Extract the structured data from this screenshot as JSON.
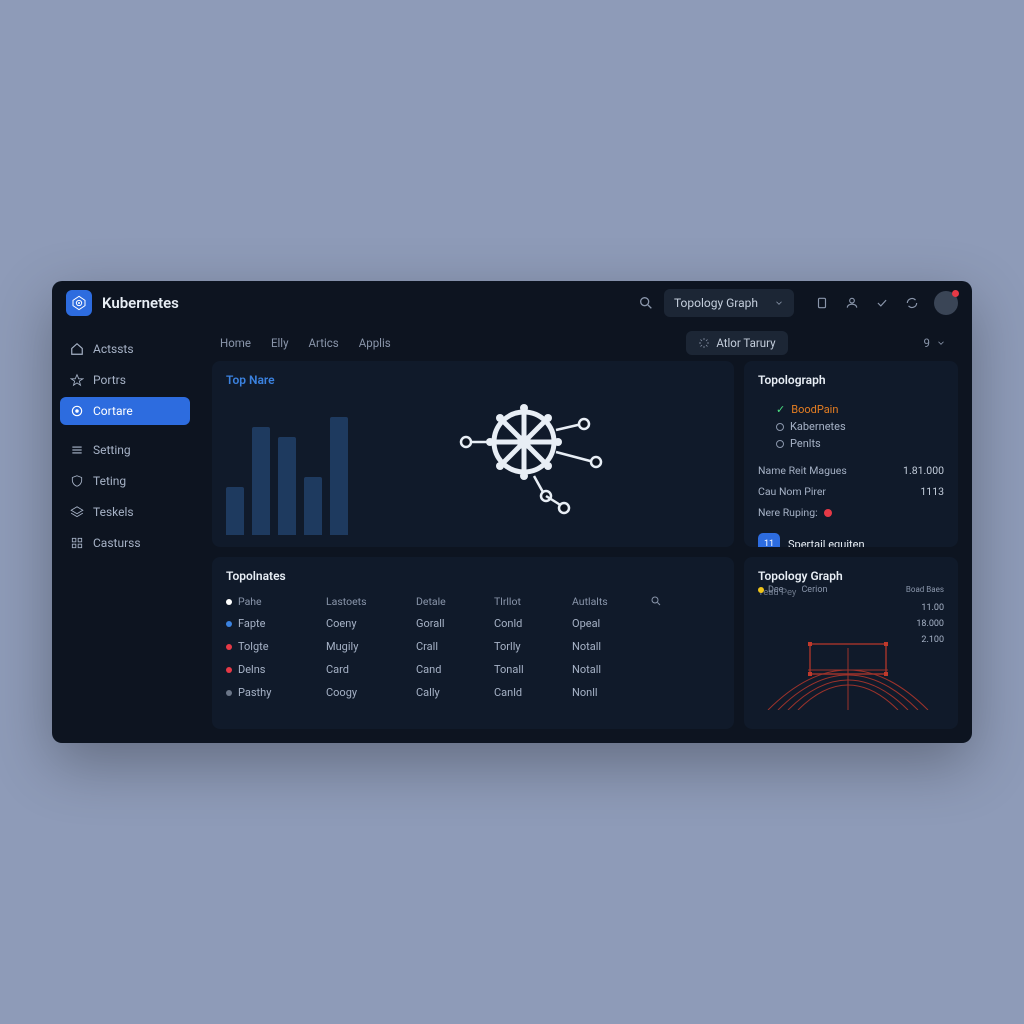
{
  "app_title": "Kubernetes",
  "header": {
    "dropdown_label": "Topology Graph"
  },
  "sidebar": {
    "items": [
      {
        "label": "Actssts"
      },
      {
        "label": "Portrs"
      },
      {
        "label": "Cortare"
      },
      {
        "label": "Setting"
      },
      {
        "label": "Teting"
      },
      {
        "label": "Teskels"
      },
      {
        "label": "Casturss"
      }
    ]
  },
  "tabs": [
    "Home",
    "Elly",
    "Artics",
    "Applis"
  ],
  "pill_label": "Atlor Tarury",
  "hero": {
    "title": "Top Nare"
  },
  "chart_data": {
    "type": "bar",
    "title": "Top Nare",
    "categories": [
      "",
      "",
      "",
      "",
      ""
    ],
    "values": [
      40,
      90,
      82,
      48,
      98
    ],
    "ylim": [
      0,
      120
    ]
  },
  "topograph": {
    "title": "Topolograph",
    "legend": [
      {
        "label": "BoodPain",
        "check": true,
        "color": "#e67e22"
      },
      {
        "label": "Kabernetes",
        "check": false
      },
      {
        "label": "Penlts",
        "check": false
      }
    ],
    "rows": [
      {
        "k": "Name Reit Magues",
        "v": "1.81.000"
      },
      {
        "k": "Cau Nom Pirer",
        "v": "1113"
      }
    ],
    "status_label": "Nere Ruping:",
    "button_label": "Spertail equiten",
    "button_badge": "11"
  },
  "table": {
    "title": "Topolnates",
    "headers": [
      "Pahe",
      "Lastoets",
      "Detale",
      "Tlrllot",
      "Autlalts"
    ],
    "rows": [
      {
        "name": "Fapte",
        "dot": "#3b82e0",
        "c": [
          "Coeny",
          "Gorall",
          "Conld",
          "Opeal"
        ]
      },
      {
        "name": "Tolgte",
        "dot": "#e63946",
        "c": [
          "Mugily",
          "Crall",
          "Torlly",
          "Notall"
        ]
      },
      {
        "name": "Delns",
        "dot": "#e63946",
        "c": [
          "Card",
          "Cand",
          "Tonall",
          "Notall"
        ]
      },
      {
        "name": "Pasthy",
        "dot": "#6b7688",
        "c": [
          "Coogy",
          "Cally",
          "Canld",
          "Nonll"
        ]
      }
    ]
  },
  "graph": {
    "title": "Topology Graph",
    "subtitle": "Teau Pey",
    "legend": [
      "Dee",
      "Cerion"
    ],
    "extra": "Boad Baes",
    "values": [
      "11.00",
      "18.000",
      "2.100"
    ]
  }
}
